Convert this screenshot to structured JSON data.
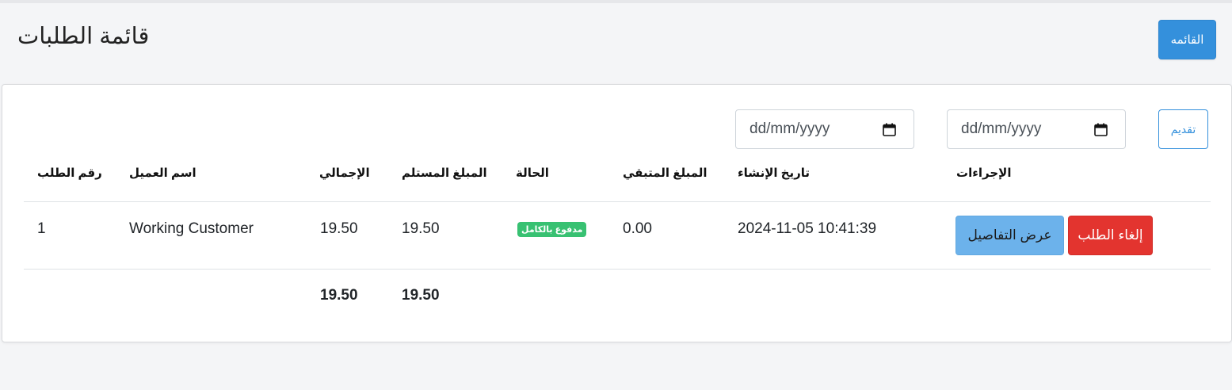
{
  "page": {
    "title": "قائمة الطلبات",
    "menu_button": "القائمه"
  },
  "filters": {
    "submit_label": "تقديم",
    "date_from_placeholder": "dd/mm/yyyy",
    "date_to_placeholder": "dd/mm/yyyy"
  },
  "table": {
    "headers": {
      "order_number": "رقم الطلب",
      "customer_name": "اسم العميل",
      "total": "الإجمالي",
      "received": "المبلغ المستلم",
      "status": "الحالة",
      "remaining": "المبلغ المتبقي",
      "created_at": "تاريخ الإنشاء",
      "actions": "الإجراءات"
    },
    "rows": [
      {
        "order_number": "1",
        "customer_name": "Working Customer",
        "total": "19.50",
        "received": "19.50",
        "status": "مدفوع بالكامل",
        "remaining": "0.00",
        "created_at": "2024-11-05 10:41:39",
        "details_label": "عرض التفاصيل",
        "cancel_label": "إلغاء الطلب"
      }
    ],
    "footer": {
      "total": "19.50",
      "received": "19.50"
    }
  },
  "colors": {
    "primary": "#3490dc",
    "success": "#38c172",
    "info": "#6cb2eb",
    "danger": "#e3342f"
  }
}
